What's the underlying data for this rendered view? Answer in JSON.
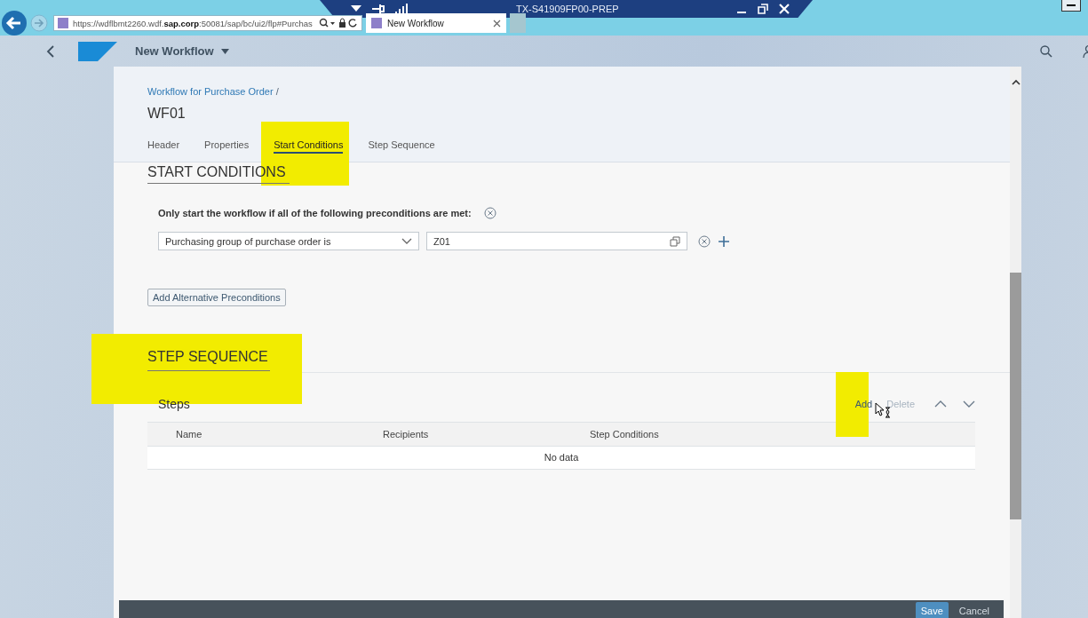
{
  "browser": {
    "url": "https://wdflbmt2260.wdf.**sap.corp**:50081/sap/bc/ui2/flp#Purchas",
    "tab_title": "New Workflow"
  },
  "remote_title": "TX-S41909FP00-PREP",
  "shell": {
    "app_title": "New Workflow"
  },
  "breadcrumb": {
    "link": "Workflow for Purchase Order",
    "separator": "/"
  },
  "object_title": "WF01",
  "tabs": [
    {
      "label": "Header",
      "selected": false
    },
    {
      "label": "Properties",
      "selected": false
    },
    {
      "label": "Start Conditions",
      "selected": true
    },
    {
      "label": "Step Sequence",
      "selected": false
    }
  ],
  "start_conditions": {
    "heading": "START CONDITIONS",
    "intro": "Only start the workflow if all of the following preconditions are met:",
    "conditions": [
      {
        "attribute": "Purchasing group of purchase order is",
        "value": "Z01"
      }
    ],
    "add_button": "Add Alternative Preconditions"
  },
  "step_sequence": {
    "heading": "STEP SEQUENCE",
    "table_title": "Steps",
    "actions": [
      {
        "label": "Add",
        "disabled": false
      },
      {
        "label": "Delete",
        "disabled": true
      }
    ],
    "columns": [
      "Name",
      "Recipients",
      "Step Conditions"
    ],
    "empty_text": "No data"
  },
  "footer": {
    "buttons": [
      {
        "label": "Save",
        "kind": "emphasized"
      },
      {
        "label": "Cancel",
        "kind": "transparent"
      }
    ]
  }
}
